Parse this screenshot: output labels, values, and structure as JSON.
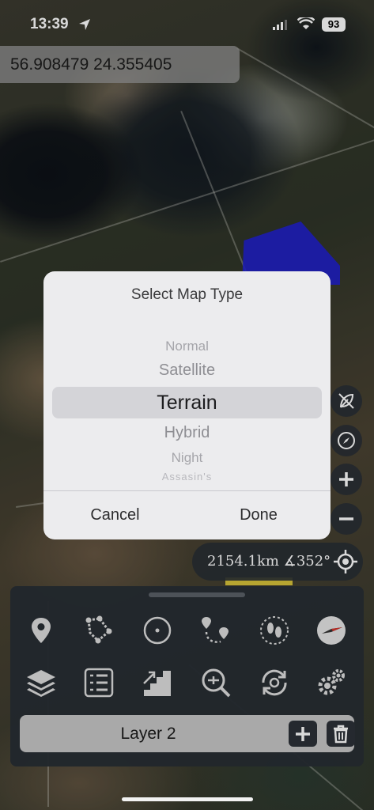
{
  "status_bar": {
    "time": "13:39",
    "battery": "93"
  },
  "map": {
    "coordinates": "56.908479 24.355405",
    "distance_readout": "2154.1km ∡352°"
  },
  "dialog": {
    "title": "Select Map Type",
    "options": [
      "Normal",
      "Satellite",
      "Terrain",
      "Hybrid",
      "Night",
      "Assasin's"
    ],
    "selected": "Terrain",
    "cancel_label": "Cancel",
    "done_label": "Done"
  },
  "toolbar": {
    "row1": [
      "marker-pin-icon",
      "polygon-ruler-icon",
      "circle-icon",
      "route-icon",
      "footprints-icon",
      "compass-icon"
    ],
    "row2": [
      "layers-icon",
      "checklist-icon",
      "elevation-icon",
      "zoom-fit-icon",
      "sync-icon",
      "settings-icon"
    ]
  },
  "layer_bar": {
    "label": "Layer 2"
  },
  "colors": {
    "panel": "#282e34",
    "dialog": "#ececee",
    "zone_blue": "#1f1fd8",
    "zone_yellow": "#d8c23a"
  }
}
